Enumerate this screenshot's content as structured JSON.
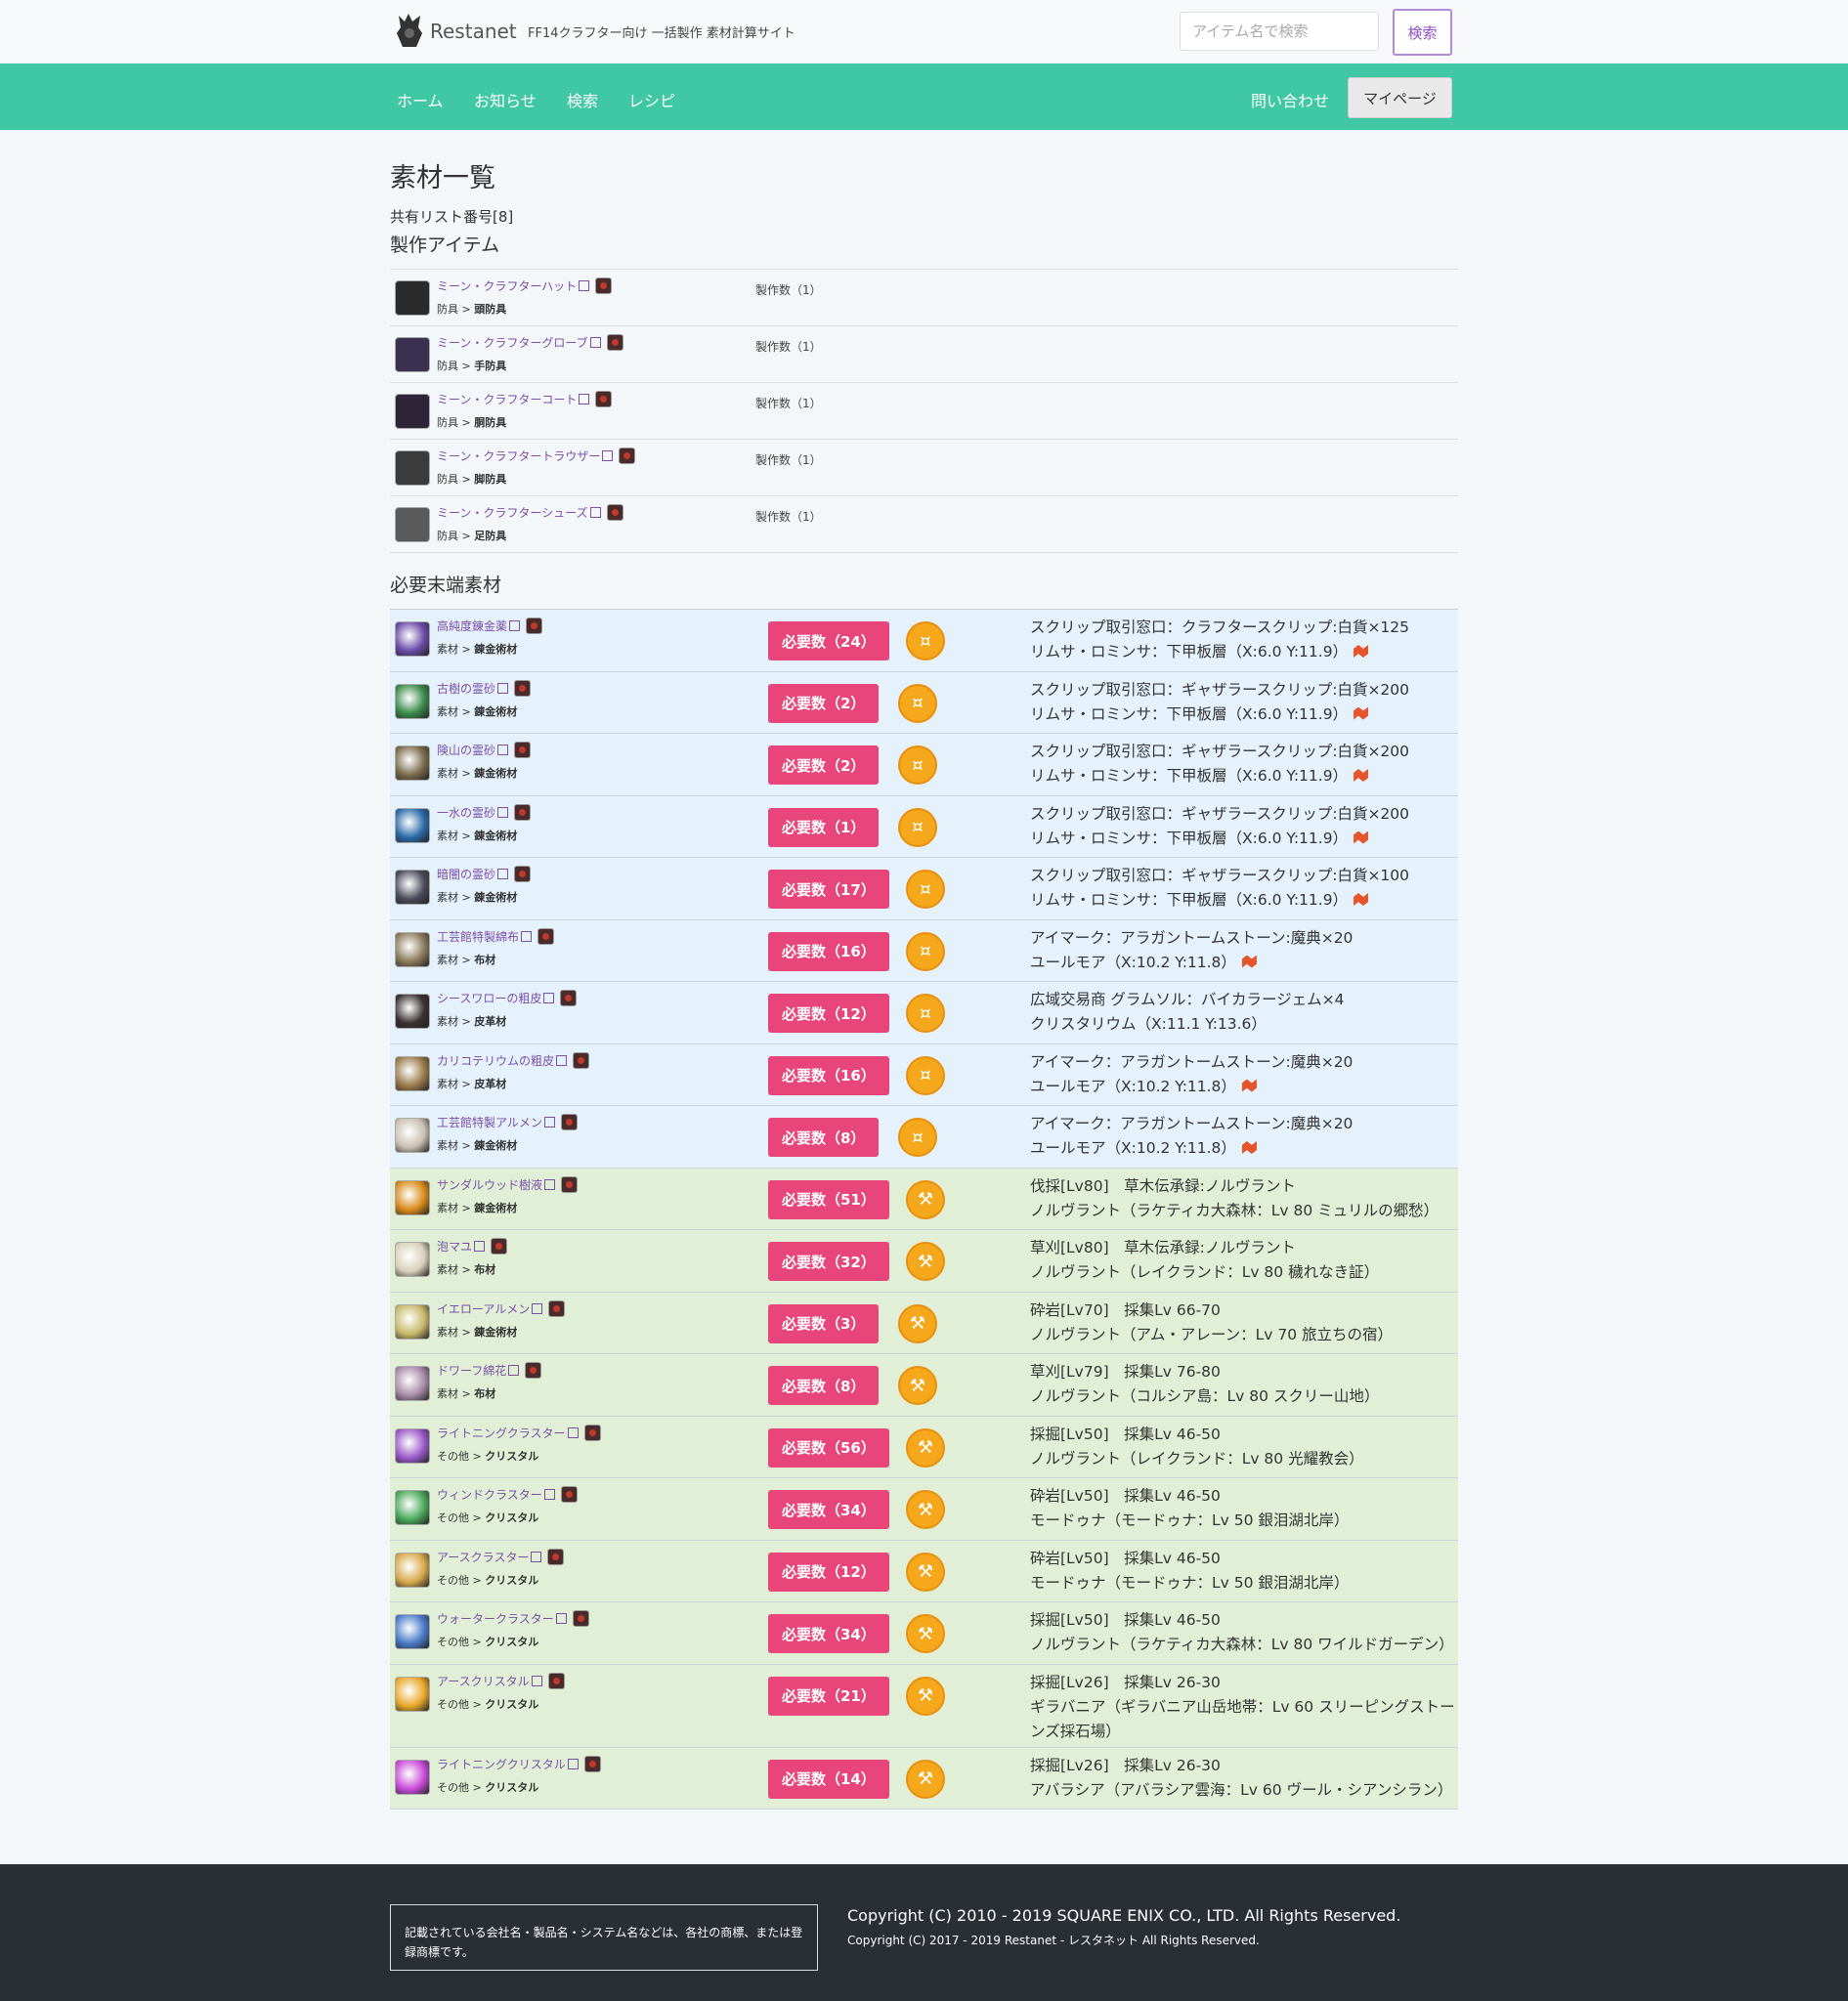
{
  "header": {
    "brand": "Restanet",
    "tagline": "FF14クラフター向け 一括製作 素材計算サイト",
    "search_placeholder": "アイテム名で検索",
    "search_button": "検索"
  },
  "nav": {
    "items": [
      "ホーム",
      "お知らせ",
      "検索",
      "レシピ"
    ],
    "contact": "問い合わせ",
    "mypage": "マイページ"
  },
  "page": {
    "title": "素材一覧",
    "share_id": "共有リスト番号[8]",
    "craft_section": "製作アイテム",
    "material_section": "必要末端素材"
  },
  "craft_items": [
    {
      "name": "ミーン・クラフターハット",
      "cat": "防具",
      "sub": "頭防具",
      "count": "製作数（1）",
      "color": "#2b2b2b"
    },
    {
      "name": "ミーン・クラフターグローブ",
      "cat": "防具",
      "sub": "手防具",
      "count": "製作数（1）",
      "color": "#3a3050"
    },
    {
      "name": "ミーン・クラフターコート",
      "cat": "防具",
      "sub": "胴防具",
      "count": "製作数（1）",
      "color": "#2d2438"
    },
    {
      "name": "ミーン・クラフタートラウザー",
      "cat": "防具",
      "sub": "脚防具",
      "count": "製作数（1）",
      "color": "#3b3b3b"
    },
    {
      "name": "ミーン・クラフターシューズ",
      "cat": "防具",
      "sub": "足防具",
      "count": "製作数（1）",
      "color": "#5a5a5a"
    }
  ],
  "materials": [
    {
      "name": "高純度錬金薬",
      "cat": "素材",
      "sub": "錬金術材",
      "need": "必要数（24）",
      "line1": "スクリップ取引窓口：クラフタースクリップ:白貨×125",
      "line2": "リムサ・ロミンサ：下甲板層（X:6.0 Y:11.9）",
      "map": true,
      "bg": "blue",
      "icon": "coin",
      "color": "#6a4aa8"
    },
    {
      "name": "古樹の霊砂",
      "cat": "素材",
      "sub": "錬金術材",
      "need": "必要数（2）",
      "line1": "スクリップ取引窓口：ギャザラースクリップ:白貨×200",
      "line2": "リムサ・ロミンサ：下甲板層（X:6.0 Y:11.9）",
      "map": true,
      "bg": "blue",
      "icon": "coin",
      "color": "#3a8a4a"
    },
    {
      "name": "険山の霊砂",
      "cat": "素材",
      "sub": "錬金術材",
      "need": "必要数（2）",
      "line1": "スクリップ取引窓口：ギャザラースクリップ:白貨×200",
      "line2": "リムサ・ロミンサ：下甲板層（X:6.0 Y:11.9）",
      "map": true,
      "bg": "blue",
      "icon": "coin",
      "color": "#7a6a4a"
    },
    {
      "name": "一水の霊砂",
      "cat": "素材",
      "sub": "錬金術材",
      "need": "必要数（1）",
      "line1": "スクリップ取引窓口：ギャザラースクリップ:白貨×200",
      "line2": "リムサ・ロミンサ：下甲板層（X:6.0 Y:11.9）",
      "map": true,
      "bg": "blue",
      "icon": "coin",
      "color": "#2a6aa8"
    },
    {
      "name": "暗闇の霊砂",
      "cat": "素材",
      "sub": "錬金術材",
      "need": "必要数（17）",
      "line1": "スクリップ取引窓口：ギャザラースクリップ:白貨×100",
      "line2": "リムサ・ロミンサ：下甲板層（X:6.0 Y:11.9）",
      "map": true,
      "bg": "blue",
      "icon": "coin",
      "color": "#4a4a5a"
    },
    {
      "name": "工芸館特製綿布",
      "cat": "素材",
      "sub": "布材",
      "need": "必要数（16）",
      "line1": "アイマーク：アラガントームストーン:魔典×20",
      "line2": "ユールモア（X:10.2 Y:11.8）",
      "map": true,
      "bg": "blue",
      "icon": "coin",
      "color": "#8a7a5a"
    },
    {
      "name": "シースワローの粗皮",
      "cat": "素材",
      "sub": "皮革材",
      "need": "必要数（12）",
      "line1": "広域交易商 グラムソル：バイカラージェム×4",
      "line2": "クリスタリウム（X:11.1 Y:13.6）",
      "map": false,
      "bg": "blue",
      "icon": "coin",
      "color": "#3a3030"
    },
    {
      "name": "カリコテリウムの粗皮",
      "cat": "素材",
      "sub": "皮革材",
      "need": "必要数（16）",
      "line1": "アイマーク：アラガントームストーン:魔典×20",
      "line2": "ユールモア（X:10.2 Y:11.8）",
      "map": true,
      "bg": "blue",
      "icon": "coin",
      "color": "#9a7a4a"
    },
    {
      "name": "工芸館特製アルメン",
      "cat": "素材",
      "sub": "錬金術材",
      "need": "必要数（8）",
      "line1": "アイマーク：アラガントームストーン:魔典×20",
      "line2": "ユールモア（X:10.2 Y:11.8）",
      "map": true,
      "bg": "blue",
      "icon": "coin",
      "color": "#c8c0b0"
    },
    {
      "name": "サンダルウッド樹液",
      "cat": "素材",
      "sub": "錬金術材",
      "need": "必要数（51）",
      "line1": "伐採[Lv80]　草木伝承録:ノルヴラント",
      "line2": "ノルヴラント（ラケティカ大森林：Lv 80 ミュリルの郷愁）",
      "map": false,
      "bg": "green",
      "icon": "tool",
      "color": "#d88a1a"
    },
    {
      "name": "泡マユ",
      "cat": "素材",
      "sub": "布材",
      "need": "必要数（32）",
      "line1": "草刈[Lv80]　草木伝承録:ノルヴラント",
      "line2": "ノルヴラント（レイクランド：Lv 80 穢れなき証）",
      "map": false,
      "bg": "green",
      "icon": "tool",
      "color": "#d8d0b8"
    },
    {
      "name": "イエローアルメン",
      "cat": "素材",
      "sub": "錬金術材",
      "need": "必要数（3）",
      "line1": "砕岩[Lv70]　採集Lv 66-70",
      "line2": "ノルヴラント（アム・アレーン：Lv 70 旅立ちの宿）",
      "map": false,
      "bg": "green",
      "icon": "tool",
      "color": "#c8b868"
    },
    {
      "name": "ドワーフ綿花",
      "cat": "素材",
      "sub": "布材",
      "need": "必要数（8）",
      "line1": "草刈[Lv79]　採集Lv 76-80",
      "line2": "ノルヴラント（コルシア島：Lv 80 スクリー山地）",
      "map": false,
      "bg": "green",
      "icon": "tool",
      "color": "#a88aa8"
    },
    {
      "name": "ライトニングクラスター",
      "cat": "その他",
      "sub": "クリスタル",
      "need": "必要数（56）",
      "line1": "採掘[Lv50]　採集Lv 46-50",
      "line2": "ノルヴラント（レイクランド：Lv 80 光耀教会）",
      "map": false,
      "bg": "green",
      "icon": "tool",
      "color": "#9a5ac8"
    },
    {
      "name": "ウィンドクラスター",
      "cat": "その他",
      "sub": "クリスタル",
      "need": "必要数（34）",
      "line1": "砕岩[Lv50]　採集Lv 46-50",
      "line2": "モードゥナ（モードゥナ：Lv 50 銀泪湖北岸）",
      "map": false,
      "bg": "green",
      "icon": "tool",
      "color": "#4aa85a"
    },
    {
      "name": "アースクラスター",
      "cat": "その他",
      "sub": "クリスタル",
      "need": "必要数（12）",
      "line1": "砕岩[Lv50]　採集Lv 46-50",
      "line2": "モードゥナ（モードゥナ：Lv 50 銀泪湖北岸）",
      "map": false,
      "bg": "green",
      "icon": "tool",
      "color": "#d8a84a"
    },
    {
      "name": "ウォータークラスター",
      "cat": "その他",
      "sub": "クリスタル",
      "need": "必要数（34）",
      "line1": "採掘[Lv50]　採集Lv 46-50",
      "line2": "ノルヴラント（ラケティカ大森林：Lv 80 ワイルドガーデン）",
      "map": false,
      "bg": "green",
      "icon": "tool",
      "color": "#4a7ac8"
    },
    {
      "name": "アースクリスタル",
      "cat": "その他",
      "sub": "クリスタル",
      "need": "必要数（21）",
      "line1": "採掘[Lv26]　採集Lv 26-30",
      "line2": "ギラバニア（ギラバニア山岳地帯：Lv 60 スリーピングストーンズ採石場）",
      "map": false,
      "bg": "green",
      "icon": "tool",
      "color": "#e8a82a"
    },
    {
      "name": "ライトニングクリスタル",
      "cat": "その他",
      "sub": "クリスタル",
      "need": "必要数（14）",
      "line1": "採掘[Lv26]　採集Lv 26-30",
      "line2": "アバラシア（アバラシア雲海：Lv 60 ヴール・シアンシラン）",
      "map": false,
      "bg": "green",
      "icon": "tool",
      "color": "#c84ad8"
    }
  ],
  "footer": {
    "notice": "記載されている会社名・製品名・システム名などは、各社の商標、または登録商標です。",
    "copyright1": "Copyright (C) 2010 - 2019 SQUARE ENIX CO., LTD. All Rights Reserved.",
    "copyright2": "Copyright (C) 2017 - 2019 Restanet - レスタネット All Rights Reserved."
  }
}
